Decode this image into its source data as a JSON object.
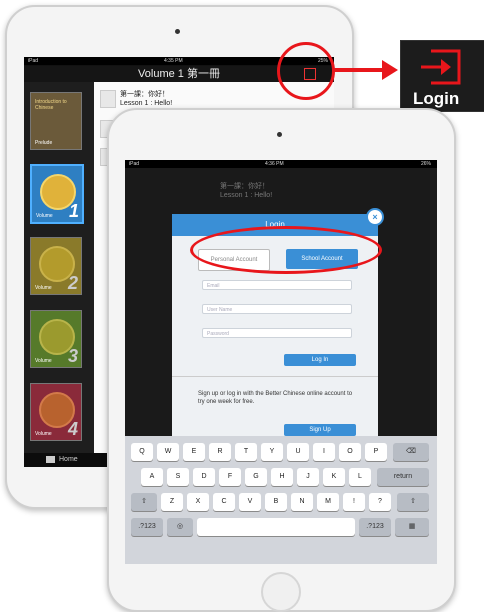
{
  "back_ipad": {
    "status": {
      "left": "iPad",
      "time": "4:35 PM",
      "battery": "25%"
    },
    "nav_title": "Volume 1 第一冊",
    "books": [
      {
        "label": "Prelude",
        "title": "Introduction to Chinese",
        "number": ""
      },
      {
        "label": "Volume",
        "number": "1"
      },
      {
        "label": "Volume",
        "number": "2"
      },
      {
        "label": "Volume",
        "number": "3"
      },
      {
        "label": "Volume",
        "number": "4"
      }
    ],
    "lesson_line1": "第一課：你好！",
    "lesson_line2": "Lesson 1 : Hello!",
    "tab_home": "Home"
  },
  "callout": {
    "label": "Login"
  },
  "front_ipad": {
    "status": {
      "left": "iPad",
      "time": "4:36 PM",
      "battery": "26%"
    },
    "lesson_line1": "第一課：你好！",
    "lesson_line2": "Lesson 1 : Hello!",
    "modal": {
      "header": "Login",
      "tab_personal": "Personal Account",
      "tab_school": "School Account",
      "email_placeholder": "Email",
      "username_placeholder": "User Name",
      "password_placeholder": "Password",
      "login_button": "Log In",
      "signup_text": "Sign up or log in with the Better Chinese online account to try one week for free.",
      "signup_button": "Sign Up"
    },
    "keyboard": {
      "row1": [
        "Q",
        "W",
        "E",
        "R",
        "T",
        "Y",
        "U",
        "I",
        "O",
        "P"
      ],
      "row2": [
        "A",
        "S",
        "D",
        "F",
        "G",
        "H",
        "J",
        "K",
        "L"
      ],
      "row3": [
        "Z",
        "X",
        "C",
        "V",
        "B",
        "N",
        "M",
        "!",
        "?"
      ],
      "return": "return",
      "numbers": ".?123"
    }
  },
  "colors": {
    "highlight": "#e8161b",
    "accent": "#3a8fd6"
  }
}
